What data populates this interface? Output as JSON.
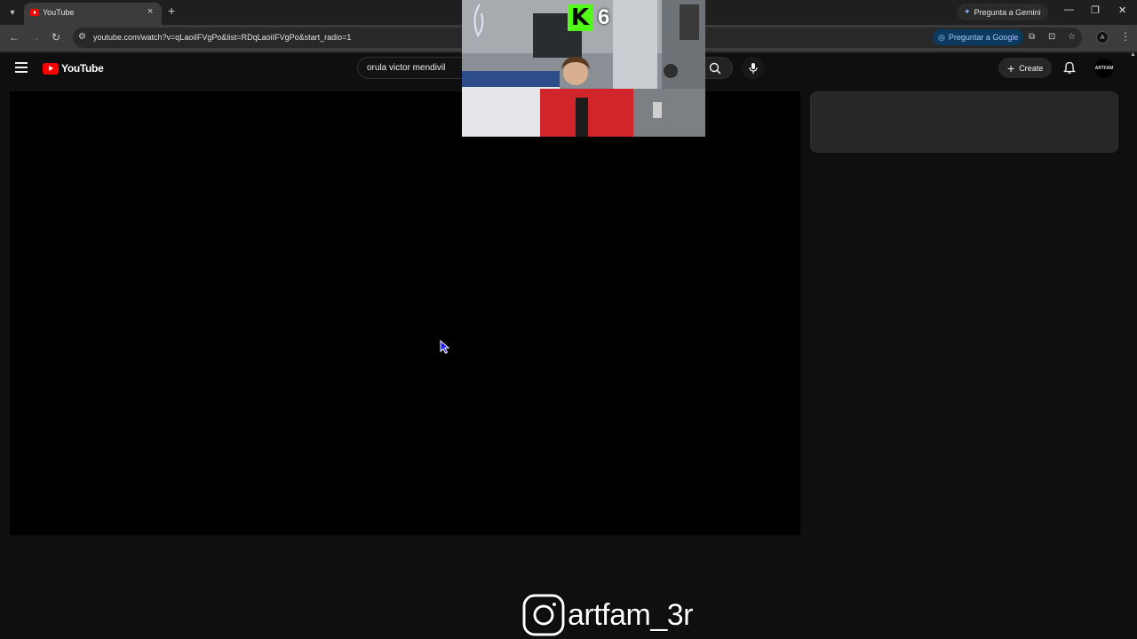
{
  "browser": {
    "tab": {
      "title": "YouTube",
      "close_glyph": "×"
    },
    "new_tab_glyph": "+",
    "gemini_label": "Pregunta a Gemini",
    "window_controls": {
      "minimize": "—",
      "restore": "❐",
      "close": "✕"
    },
    "url": "youtube.com/watch?v=qLaoiIFVgPo&list=RDqLaoiIFVgPo&start_radio=1",
    "ask_google_label": "Preguntar a Google",
    "loading_progress": 0
  },
  "youtube": {
    "logo_text": "YouTube",
    "search_query": "orula victor mendivil",
    "create_label": "Create",
    "avatar_text": "ARTFAM"
  },
  "overlay": {
    "kick_letter": "K",
    "kick_count": "6",
    "instagram_handle": "artfam_3r"
  },
  "colors": {
    "yt_red": "#ff0000",
    "kick_green": "#53fc18",
    "background": "#0f0f0f"
  },
  "icons": [
    "tab-list-icon",
    "youtube-favicon",
    "new-tab-icon",
    "gemini-icon",
    "back-icon",
    "forward-icon",
    "reload-icon",
    "site-info-icon",
    "translate-icon",
    "install-icon",
    "bookmark-star-icon",
    "menu-dots-icon",
    "hamburger-icon",
    "search-icon",
    "mic-icon",
    "bell-icon",
    "instagram-icon",
    "cursor-icon"
  ]
}
